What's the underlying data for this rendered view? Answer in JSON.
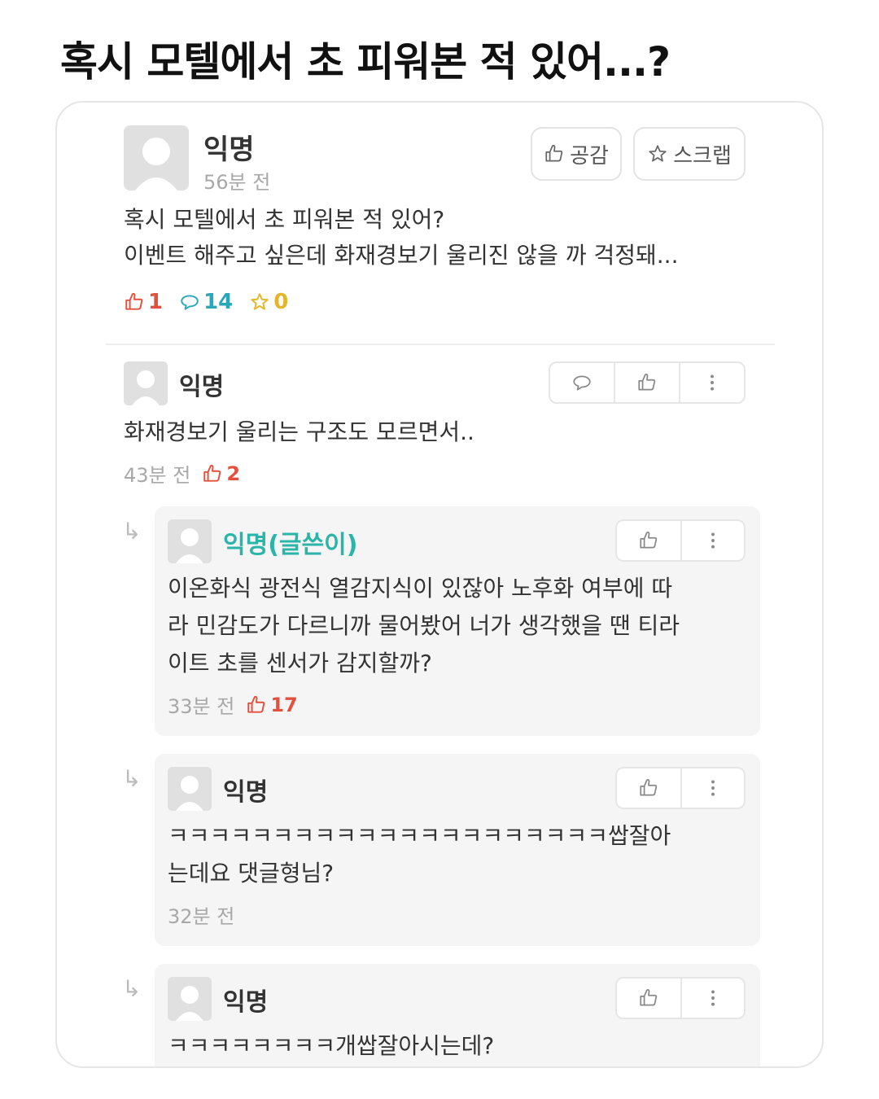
{
  "headline": "혹시 모텔에서 초 피워본 적 있어...?",
  "post": {
    "author": "익명",
    "time": "56분 전",
    "like_button": "공감",
    "scrap_button": "스크랩",
    "body_lines": [
      "혹시 모텔에서 초 피워본 적 있어?",
      "이벤트 해주고 싶은데 화재경보기 울리진 않을 까 걱정돼..."
    ],
    "stats": {
      "likes": "1",
      "comments": "14",
      "scraps": "0"
    }
  },
  "comments": [
    {
      "author": "익명",
      "lines": [
        "화재경보기 울리는 구조도 모르면서.."
      ],
      "time": "43분 전",
      "likes": "2"
    }
  ],
  "replies": [
    {
      "author": "익명(글쓴이)",
      "is_author": true,
      "lines": [
        "이온화식 광전식 열감지식이 있잖아 노후화 여부에 따",
        "라 민감도가 다르니까 물어봤어 너가 생각했을 땐 티라",
        "이트 초를 센서가 감지할까?"
      ],
      "time": "33분 전",
      "likes": "17"
    },
    {
      "author": "익명",
      "is_author": false,
      "lines": [
        "ㅋㅋㅋㅋㅋㅋㅋㅋㅋㅋㅋㅋㅋㅋㅋㅋㅋㅋㅋㅋㅋ쌉잘아",
        "는데요 댓글형님?"
      ],
      "time": "32분 전",
      "likes": ""
    },
    {
      "author": "익명",
      "is_author": false,
      "lines": [
        "ㅋㅋㅋㅋㅋㅋㅋㅋ개쌉잘아시는데?"
      ],
      "time": "",
      "likes": ""
    }
  ],
  "icons": {
    "thumb": "thumbs-up-icon",
    "bubble": "speech-bubble-icon",
    "star": "star-icon",
    "more": "more-vertical-icon",
    "reply": "reply-arrow-icon"
  },
  "colors": {
    "like": "#e2503e",
    "comment": "#2aa7b8",
    "scrap": "#e5b52b",
    "author_name": "#2bb5a9"
  }
}
